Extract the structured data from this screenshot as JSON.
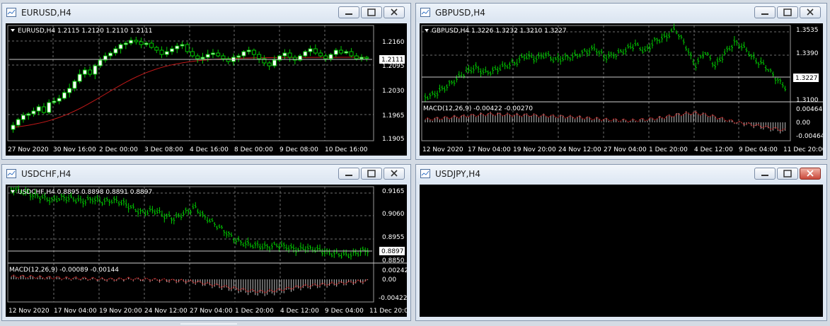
{
  "colors": {
    "background": "#000000",
    "grid": "#8a8a8a",
    "axis_text": "#ffffff",
    "bull_candle": "#ffffff",
    "bear_candle": "#000000",
    "bar_line": "#00c800",
    "ma_line": "#c01818",
    "macd_hist": "#c0c0c0",
    "macd_signal": "#c01818",
    "price_line": "#c8c8c8"
  },
  "windows": [
    {
      "id": "eurusd",
      "title": "EURUSD,H4",
      "info": "EURUSD,H4  1.2115 1.2120 1.2110 1.2111",
      "style": "candles",
      "price_axis": [
        "1.2160",
        "1.2095",
        "1.2030",
        "1.1965",
        "1.1905"
      ],
      "current_price": "1.2111",
      "time_axis": [
        "27 Nov 2020",
        "30 Nov 16:00",
        "2 Dec 00:00",
        "3 Dec 08:00",
        "4 Dec 16:00",
        "8 Dec 00:00",
        "9 Dec 08:00",
        "10 Dec 16:00"
      ]
    },
    {
      "id": "gbpusd",
      "title": "GBPUSD,H4",
      "info": "GBPUSD,H4  1.3226 1.3232 1.3210 1.3227",
      "style": "bars",
      "price_axis": [
        "1.3535",
        "1.3390",
        "1.3100"
      ],
      "current_price": "1.3227",
      "macd_label": "MACD(12,26,9) -0.00422 -0.00270",
      "macd_axis": [
        "0.00464",
        "0.00",
        "-0.00464"
      ],
      "time_axis": [
        "12 Nov 2020",
        "17 Nov 04:00",
        "19 Nov 20:00",
        "24 Nov 12:00",
        "27 Nov 04:00",
        "1 Dec 20:00",
        "4 Dec 12:00",
        "9 Dec 04:00",
        "11 Dec 20:00"
      ]
    },
    {
      "id": "usdchf",
      "title": "USDCHF,H4",
      "info": "USDCHF,H4  0.8895 0.8898 0.8891 0.8897",
      "style": "bars",
      "price_axis": [
        "0.9165",
        "0.9060",
        "0.8955",
        "0.8850"
      ],
      "current_price": "0.8897",
      "macd_label": "MACD(12,26,9) -0.00089 -0.00144",
      "macd_axis": [
        "0.00242",
        "0.00",
        "-0.00422"
      ],
      "time_axis": [
        "12 Nov 2020",
        "17 Nov 04:00",
        "19 Nov 20:00",
        "24 Nov 12:00",
        "27 Nov 04:00",
        "1 Dec 20:00",
        "4 Dec 12:00",
        "9 Dec 04:00",
        "11 Dec 20:00"
      ]
    },
    {
      "id": "usdjpy",
      "title": "USDJPY,H4",
      "style": "empty"
    }
  ]
}
